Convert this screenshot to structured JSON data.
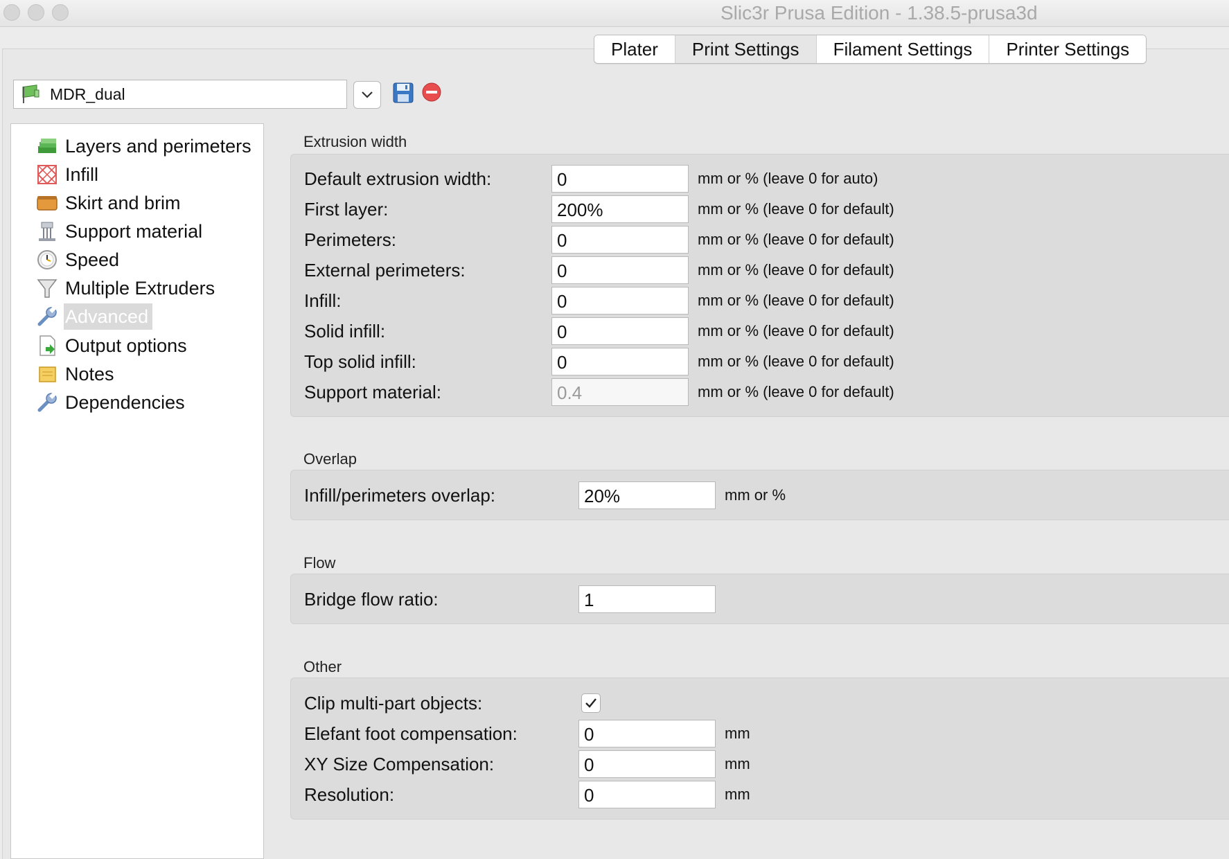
{
  "window": {
    "title": "Slic3r Prusa Edition - 1.38.5-prusa3d"
  },
  "tabs": [
    {
      "label": "Plater"
    },
    {
      "label": "Print Settings",
      "active": true
    },
    {
      "label": "Filament Settings"
    },
    {
      "label": "Printer Settings"
    }
  ],
  "preset": {
    "name": "MDR_dual"
  },
  "sidebar": {
    "items": [
      {
        "label": "Layers and perimeters",
        "icon": "layers-icon"
      },
      {
        "label": "Infill",
        "icon": "infill-icon"
      },
      {
        "label": "Skirt and brim",
        "icon": "skirt-brim-icon"
      },
      {
        "label": "Support material",
        "icon": "support-material-icon"
      },
      {
        "label": "Speed",
        "icon": "speed-clock-icon"
      },
      {
        "label": "Multiple Extruders",
        "icon": "funnel-icon"
      },
      {
        "label": "Advanced",
        "icon": "wrench-icon",
        "selected": true
      },
      {
        "label": "Output options",
        "icon": "output-page-icon"
      },
      {
        "label": "Notes",
        "icon": "notes-icon"
      },
      {
        "label": "Dependencies",
        "icon": "wrench-icon"
      }
    ]
  },
  "sections": {
    "extrusion_width": {
      "title": "Extrusion width",
      "rows": [
        {
          "label": "Default extrusion width:",
          "value": "0",
          "unit": "mm or % (leave 0 for auto)"
        },
        {
          "label": "First layer:",
          "value": "200%",
          "unit": "mm or % (leave 0 for default)"
        },
        {
          "label": "Perimeters:",
          "value": "0",
          "unit": "mm or % (leave 0 for default)"
        },
        {
          "label": "External perimeters:",
          "value": "0",
          "unit": "mm or % (leave 0 for default)"
        },
        {
          "label": "Infill:",
          "value": "0",
          "unit": "mm or % (leave 0 for default)"
        },
        {
          "label": "Solid infill:",
          "value": "0",
          "unit": "mm or % (leave 0 for default)"
        },
        {
          "label": "Top solid infill:",
          "value": "0",
          "unit": "mm or % (leave 0 for default)"
        },
        {
          "label": "Support material:",
          "value": "0.4",
          "unit": "mm or % (leave 0 for default)",
          "disabled": true
        }
      ]
    },
    "overlap": {
      "title": "Overlap",
      "rows": [
        {
          "label": "Infill/perimeters overlap:",
          "value": "20%",
          "unit": "mm or %"
        }
      ]
    },
    "flow": {
      "title": "Flow",
      "rows": [
        {
          "label": "Bridge flow ratio:",
          "value": "1",
          "unit": ""
        }
      ]
    },
    "other": {
      "title": "Other",
      "clip": {
        "label": "Clip multi-part objects:",
        "checked": true
      },
      "rows": [
        {
          "label": "Elefant foot compensation:",
          "value": "0",
          "unit": "mm"
        },
        {
          "label": "XY Size Compensation:",
          "value": "0",
          "unit": "mm"
        },
        {
          "label": "Resolution:",
          "value": "0",
          "unit": "mm"
        }
      ]
    }
  },
  "colors": {
    "panel": "#dcdcdc",
    "selection": "#dadada",
    "delete": "#e84e4e",
    "save": "#3b78c4"
  }
}
